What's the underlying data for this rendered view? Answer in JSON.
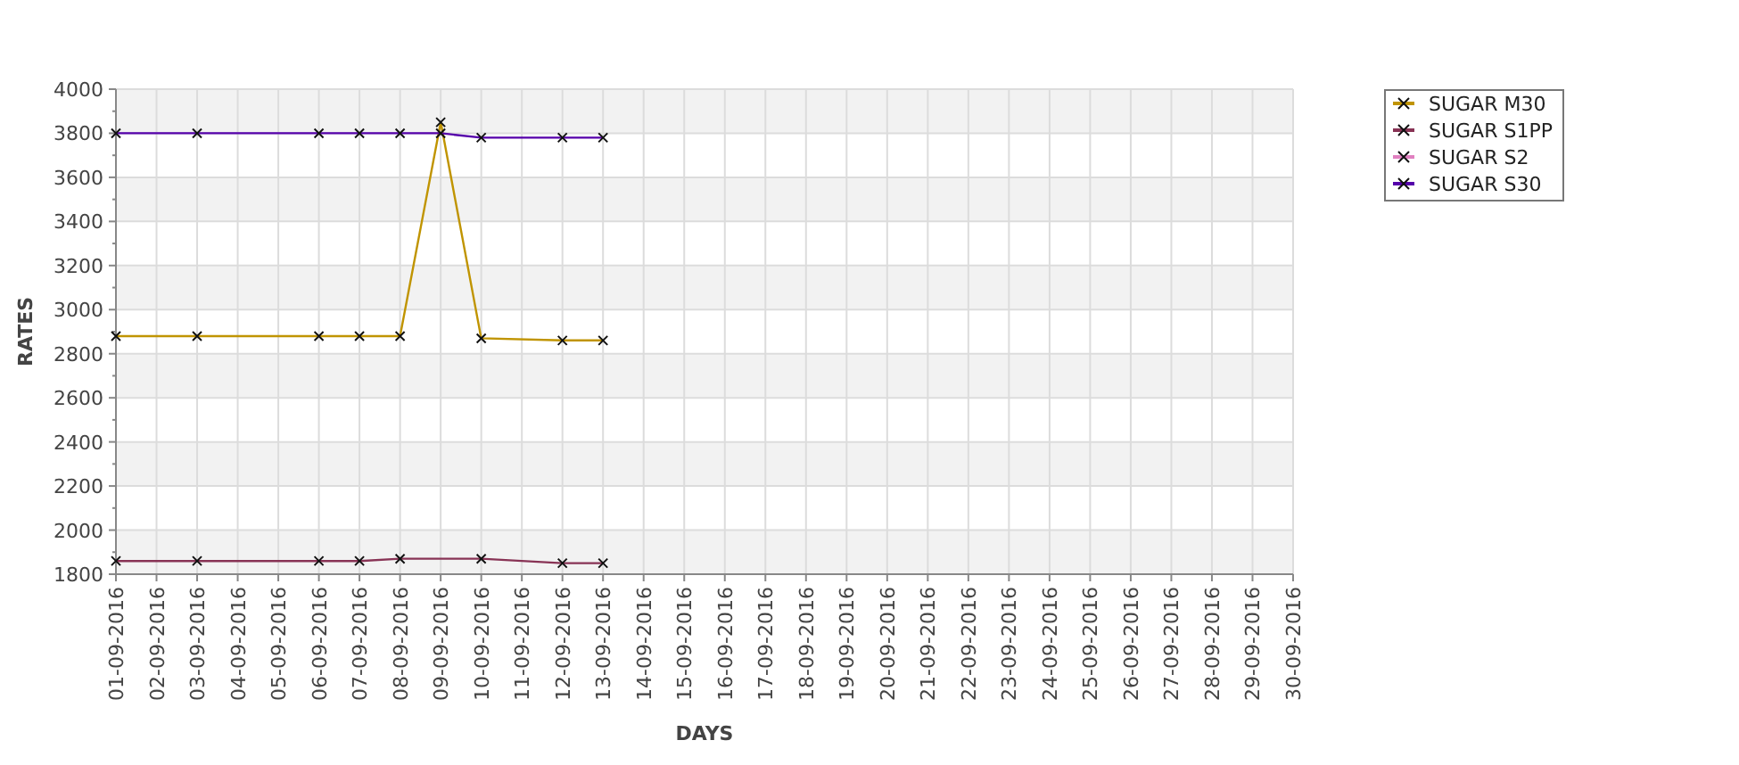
{
  "chart": {
    "chart_data": {
      "type": "line",
      "xlabel": "DAYS",
      "ylabel": "RATES",
      "grid": true,
      "legend": true,
      "categories": [
        "01-09-2016",
        "02-09-2016",
        "03-09-2016",
        "04-09-2016",
        "05-09-2016",
        "06-09-2016",
        "07-09-2016",
        "08-09-2016",
        "09-09-2016",
        "10-09-2016",
        "11-09-2016",
        "12-09-2016",
        "13-09-2016",
        "14-09-2016",
        "15-09-2016",
        "16-09-2016",
        "17-09-2016",
        "18-09-2016",
        "19-09-2016",
        "20-09-2016",
        "21-09-2016",
        "22-09-2016",
        "23-09-2016",
        "24-09-2016",
        "25-09-2016",
        "26-09-2016",
        "27-09-2016",
        "28-09-2016",
        "29-09-2016",
        "30-09-2016"
      ],
      "ylim": [
        1800,
        4000
      ],
      "yticks": [
        1800,
        2000,
        2200,
        2400,
        2600,
        2800,
        3000,
        3200,
        3400,
        3600,
        3800,
        4000
      ],
      "series": [
        {
          "name": "SUGAR M30",
          "color": "#c09400",
          "marker": "x",
          "values": [
            2880,
            null,
            2880,
            null,
            null,
            2880,
            2880,
            2880,
            3850,
            2870,
            null,
            2860,
            2860,
            null,
            null,
            null,
            null,
            null,
            null,
            null,
            null,
            null,
            null,
            null,
            null,
            null,
            null,
            null,
            null,
            null
          ]
        },
        {
          "name": "SUGAR S1PP",
          "color": "#883355",
          "marker": "x",
          "values": [
            1860,
            null,
            1860,
            null,
            null,
            1860,
            1860,
            1870,
            null,
            1870,
            null,
            1850,
            1850,
            null,
            null,
            null,
            null,
            null,
            null,
            null,
            null,
            null,
            null,
            null,
            null,
            null,
            null,
            null,
            null,
            null
          ]
        },
        {
          "name": "SUGAR S2",
          "color": "#e080c0",
          "marker": "x",
          "values": [
            null,
            null,
            null,
            null,
            null,
            null,
            null,
            null,
            null,
            null,
            null,
            null,
            null,
            null,
            null,
            null,
            null,
            null,
            null,
            null,
            null,
            null,
            null,
            null,
            null,
            null,
            null,
            null,
            null,
            null
          ]
        },
        {
          "name": "SUGAR S30",
          "color": "#5500aa",
          "marker": "x",
          "values": [
            3800,
            null,
            3800,
            null,
            null,
            3800,
            3800,
            3800,
            3800,
            3780,
            null,
            3780,
            3780,
            null,
            null,
            null,
            null,
            null,
            null,
            null,
            null,
            null,
            null,
            null,
            null,
            null,
            null,
            null,
            null,
            null
          ]
        }
      ]
    }
  }
}
